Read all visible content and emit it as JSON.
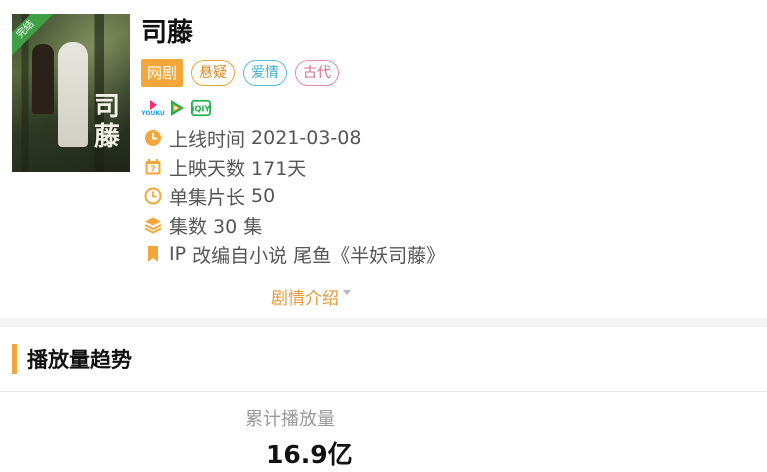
{
  "drama": {
    "title": "司藤",
    "poster_title": "司藤",
    "poster_badge": "完结",
    "type_tag": "网剧",
    "genre_tags": [
      "悬疑",
      "爱情",
      "古代"
    ],
    "platform_icons": [
      "youku-icon",
      "tencent-video-icon",
      "iqiyi-icon"
    ],
    "platform_youku_text": "YOUKU",
    "platform_iqiyi_text": "iQIY",
    "info": {
      "release": {
        "label": "上线时间",
        "value": "2021-03-08"
      },
      "days": {
        "label": "上映天数",
        "value": "171天",
        "icon_text": "7"
      },
      "duration": {
        "label": "单集片长",
        "value": "50"
      },
      "episodes": {
        "label": "集数",
        "value": "30 集"
      },
      "ip": {
        "label": "IP",
        "value": "改编自小说 尾鱼《半妖司藤》"
      }
    },
    "synopsis_label": "剧情介绍"
  },
  "section": {
    "title": "播放量趋势",
    "stat_label": "累计播放量",
    "stat_value": "16.9亿"
  },
  "colors": {
    "accent": "#f3a73a",
    "tag_mystery": "#d48b24",
    "tag_romance": "#3bb0c6",
    "tag_ancient": "#d86f8c",
    "badge_green": "#3fa045"
  }
}
